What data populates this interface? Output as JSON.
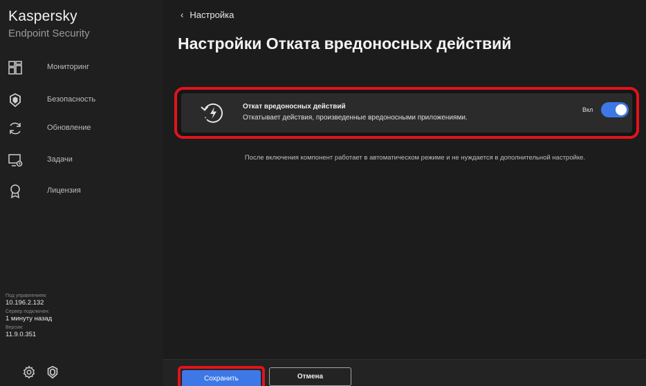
{
  "sidebar": {
    "brand": "Kaspersky",
    "product": "Endpoint Security",
    "items": [
      {
        "label": "Мониторинг",
        "icon": "dashboard-icon"
      },
      {
        "label": "Безопасность",
        "icon": "shield-icon"
      },
      {
        "label": "Обновление",
        "icon": "refresh-icon"
      },
      {
        "label": "Задачи",
        "icon": "tasks-icon"
      },
      {
        "label": "Лицензия",
        "icon": "license-icon"
      }
    ],
    "info": {
      "managed_caption": "Под управлением:",
      "managed_value": "10.196.2.132",
      "server_caption": "Сервер подключен:",
      "server_value": "1 минуту назад",
      "version_caption": "Версия:",
      "version_value": "11.9.0.351"
    },
    "bottom_icons": [
      "settings-icon",
      "shield-icon"
    ]
  },
  "main": {
    "back_label": "Настройка",
    "title": "Настройки Отката вредоносных действий",
    "card": {
      "title": "Откат вредоносных действий",
      "description": "Откатывает действия, произведенные вредоносными приложениями.",
      "toggle_label": "Вкл",
      "toggle_on": true
    },
    "note": "После включения компонент работает в автоматическом режиме и не нуждается в дополнительной настройке."
  },
  "footer": {
    "save_label": "Сохранить",
    "cancel_label": "Отмена"
  },
  "colors": {
    "accent": "#3d78e6",
    "highlight": "#e3131b",
    "background": "#1c1c1c"
  }
}
